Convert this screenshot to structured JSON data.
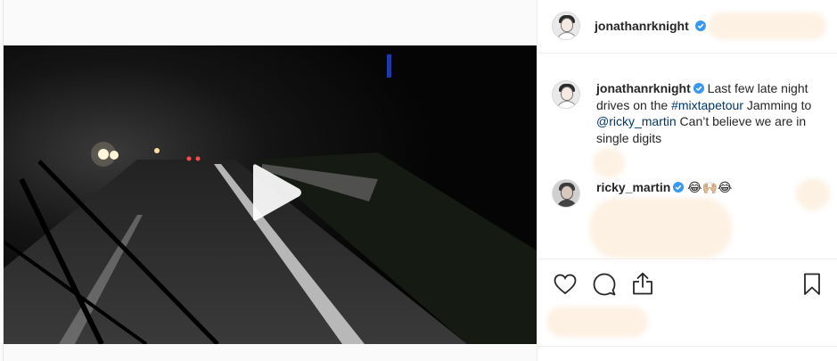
{
  "post": {
    "author": "jonathanrknight",
    "caption": {
      "username": "jonathanrknight",
      "text_before": "Last few late night drives on the ",
      "hashtag": "#mixtapetour",
      "text_middle": " Jamming to ",
      "mention": "@ricky_martin",
      "text_after": " Can’t believe we are in single digits"
    },
    "comments": [
      {
        "username": "ricky_martin",
        "text": "😂🙌🏼😂"
      }
    ]
  },
  "icons": {
    "verified": "verified-badge-icon",
    "play": "play-icon",
    "like": "heart-icon",
    "comment": "comment-bubble-icon",
    "share": "share-icon",
    "save": "bookmark-icon"
  },
  "colors": {
    "verified": "#3897f0",
    "link": "#00376b"
  }
}
